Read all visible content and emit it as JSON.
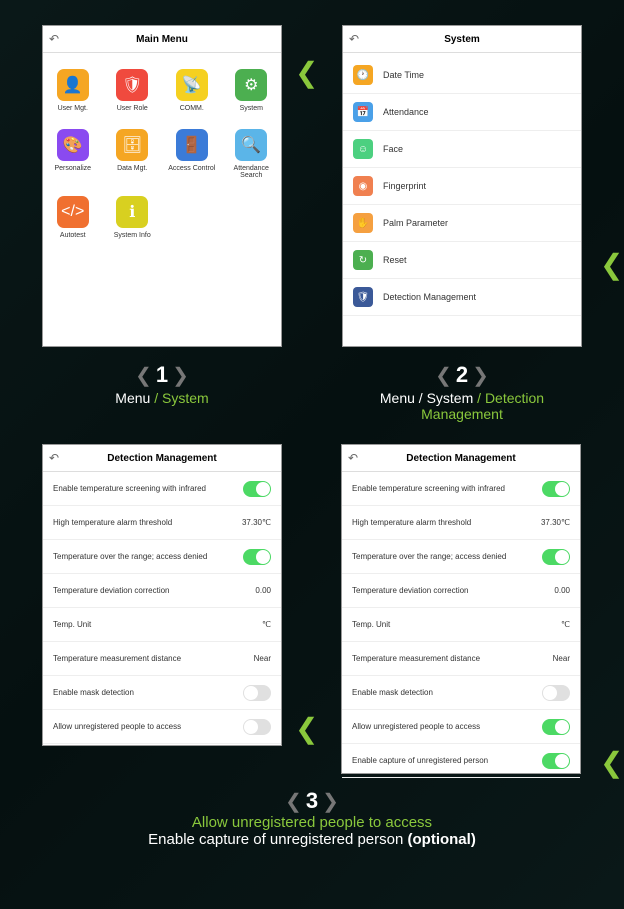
{
  "screens": {
    "mainMenu": {
      "title": "Main Menu",
      "items": [
        {
          "label": "User Mgt.",
          "color": "#f5a623",
          "glyph": "👤"
        },
        {
          "label": "User Role",
          "color": "#f04a3e",
          "glyph": "🛡"
        },
        {
          "label": "COMM.",
          "color": "#f5d020",
          "glyph": "📡"
        },
        {
          "label": "System",
          "color": "#4caf50",
          "glyph": "⚙"
        },
        {
          "label": "Personalize",
          "color": "#8a4af0",
          "glyph": "🎨"
        },
        {
          "label": "Data Mgt.",
          "color": "#f5a623",
          "glyph": "🗄"
        },
        {
          "label": "Access Control",
          "color": "#3b7bd8",
          "glyph": "🚪"
        },
        {
          "label": "Attendance Search",
          "color": "#5bb5e8",
          "glyph": "🔍"
        },
        {
          "label": "Autotest",
          "color": "#f07030",
          "glyph": "</>"
        },
        {
          "label": "System Info",
          "color": "#d8d020",
          "glyph": "ℹ"
        }
      ]
    },
    "system": {
      "title": "System",
      "rows": [
        {
          "label": "Date Time",
          "color": "#f5a623",
          "glyph": "🕐"
        },
        {
          "label": "Attendance",
          "color": "#4aa0e8",
          "glyph": "📅"
        },
        {
          "label": "Face",
          "color": "#4cd080",
          "glyph": "☺"
        },
        {
          "label": "Fingerprint",
          "color": "#f08050",
          "glyph": "◉"
        },
        {
          "label": "Palm Parameter",
          "color": "#f5a040",
          "glyph": "✋"
        },
        {
          "label": "Reset",
          "color": "#4caf50",
          "glyph": "↻"
        },
        {
          "label": "Detection Management",
          "color": "#3b5998",
          "glyph": "🛡"
        }
      ]
    },
    "detection": {
      "title": "Detection Management",
      "rowsA": [
        {
          "label": "Enable temperature screening with infrared",
          "type": "toggle",
          "on": true
        },
        {
          "label": "High temperature alarm threshold",
          "type": "value",
          "value": "37.30℃"
        },
        {
          "label": "Temperature over the range; access denied",
          "type": "toggle",
          "on": true
        },
        {
          "label": "Temperature deviation correction",
          "type": "value",
          "value": "0.00"
        },
        {
          "label": "Temp. Unit",
          "type": "value",
          "value": "℃"
        },
        {
          "label": "Temperature measurement distance",
          "type": "value",
          "value": "Near"
        },
        {
          "label": "Enable mask detection",
          "type": "toggle",
          "on": false
        },
        {
          "label": "Allow unregistered people to access",
          "type": "toggle",
          "on": false
        }
      ],
      "rowsB": [
        {
          "label": "Enable temperature screening with infrared",
          "type": "toggle",
          "on": true
        },
        {
          "label": "High temperature alarm threshold",
          "type": "value",
          "value": "37.30℃"
        },
        {
          "label": "Temperature over the range; access denied",
          "type": "toggle",
          "on": true
        },
        {
          "label": "Temperature deviation correction",
          "type": "value",
          "value": "0.00"
        },
        {
          "label": "Temp. Unit",
          "type": "value",
          "value": "℃"
        },
        {
          "label": "Temperature measurement distance",
          "type": "value",
          "value": "Near"
        },
        {
          "label": "Enable mask detection",
          "type": "toggle",
          "on": false
        },
        {
          "label": "Allow unregistered people to access",
          "type": "toggle",
          "on": true
        },
        {
          "label": "Enable capture of unregistered person",
          "type": "toggle",
          "on": true
        }
      ]
    }
  },
  "steps": {
    "s1": {
      "num": "1",
      "pre": "Menu",
      "sep": " / ",
      "hl": "System"
    },
    "s2": {
      "num": "2",
      "pre": "Menu / System",
      "sep": " / ",
      "hl": "Detection Management"
    },
    "s3": {
      "num": "3",
      "line1": "Allow unregistered people to access",
      "line2a": "Enable capture of unregistered person ",
      "line2b": "(optional)"
    }
  }
}
